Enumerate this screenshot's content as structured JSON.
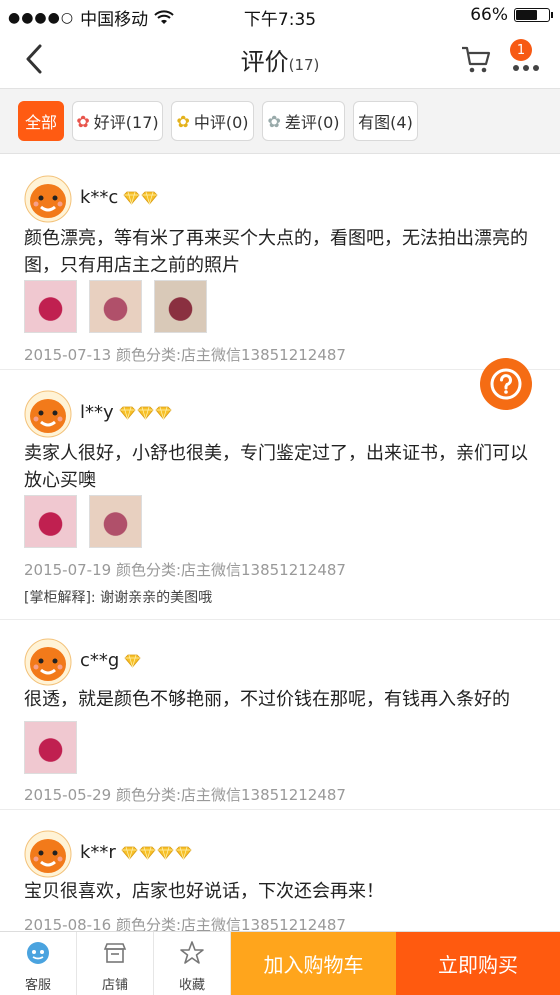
{
  "status_bar": {
    "carrier": "中国移动",
    "time": "下午7:35",
    "battery": "66%",
    "battery_level": 0.66
  },
  "header": {
    "title": "评价",
    "count": "(17)",
    "badge": "1"
  },
  "filters": [
    {
      "label": "全部",
      "active": true
    },
    {
      "label": "好评(17)"
    },
    {
      "label": "中评(0)"
    },
    {
      "label": "差评(0)"
    },
    {
      "label": "有图(4)"
    }
  ],
  "reviews": [
    {
      "user": "k**c",
      "diamonds": 2,
      "text": "颜色漂亮，等有米了再来买个大点的，看图吧，无法拍出漂亮的图，只有用店主之前的照片",
      "photos": 3,
      "meta": "2015-07-13 颜色分类:店主微信13851212487"
    },
    {
      "user": "l**y",
      "diamonds": 3,
      "text": "卖家人很好，小舒也很美，专门鉴定过了，出来证书，亲们可以放心买噢",
      "photos": 2,
      "meta": "2015-07-19 颜色分类:店主微信13851212487",
      "reply": "[掌柜解释]: 谢谢亲亲的美图哦"
    },
    {
      "user": "c**g",
      "diamonds": 1,
      "text": "很透，就是颜色不够艳丽，不过价钱在那呢，有钱再入条好的",
      "photos": 1,
      "meta": "2015-05-29 颜色分类:店主微信13851212487"
    },
    {
      "user": "k**r",
      "diamonds": 4,
      "text": "宝贝很喜欢，店家也好说话，下次还会再来！",
      "photos": 0,
      "meta": "2015-08-16 颜色分类:店主微信13851212487"
    }
  ],
  "bottom_bar": {
    "service": "客服",
    "shop": "店铺",
    "favorite": "收藏",
    "add_cart": "加入购物车",
    "buy_now": "立即购买"
  },
  "colors": {
    "accent": "#ff5b12",
    "add_cart": "#ffa51c",
    "buy_now": "#ff5a0f",
    "diamond": "#f7c028"
  }
}
